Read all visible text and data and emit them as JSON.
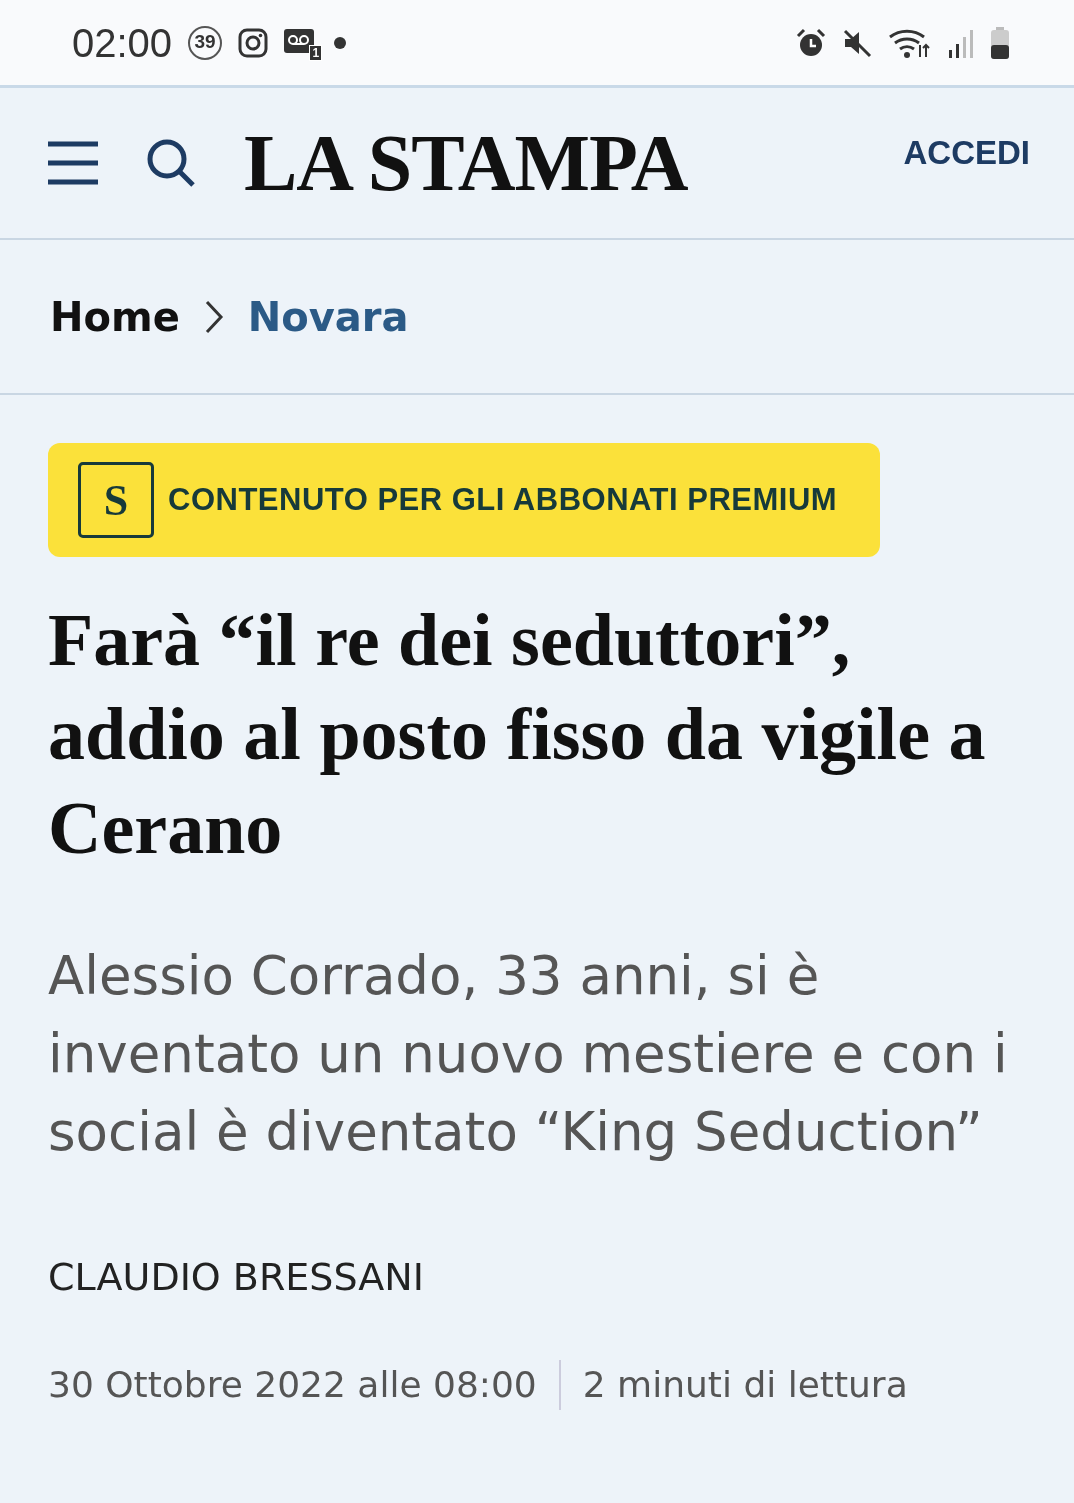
{
  "status_bar": {
    "time": "02:00",
    "notification_count": "39",
    "voicemail_count": "1"
  },
  "header": {
    "logo": "LA STAMPA",
    "login": "ACCEDI"
  },
  "breadcrumb": [
    {
      "label": "Home",
      "kind": "plain"
    },
    {
      "label": "Novara",
      "kind": "link"
    }
  ],
  "premium_banner": {
    "mark": "S",
    "label": "CONTENUTO PER GLI ABBONATI PREMIUM"
  },
  "headline": "Farà “il re dei seduttori”, addio al posto fisso da vigile a Cerano",
  "subtitle": "Alessio Corrado, 33 anni, si è inventato un nuovo mestiere e con i social è diventato “King Seduction”",
  "author": "CLAUDIO BRESSANI",
  "date": "30 Ottobre 2022 alle 08:00",
  "reading_time": "2 minuti di lettura"
}
